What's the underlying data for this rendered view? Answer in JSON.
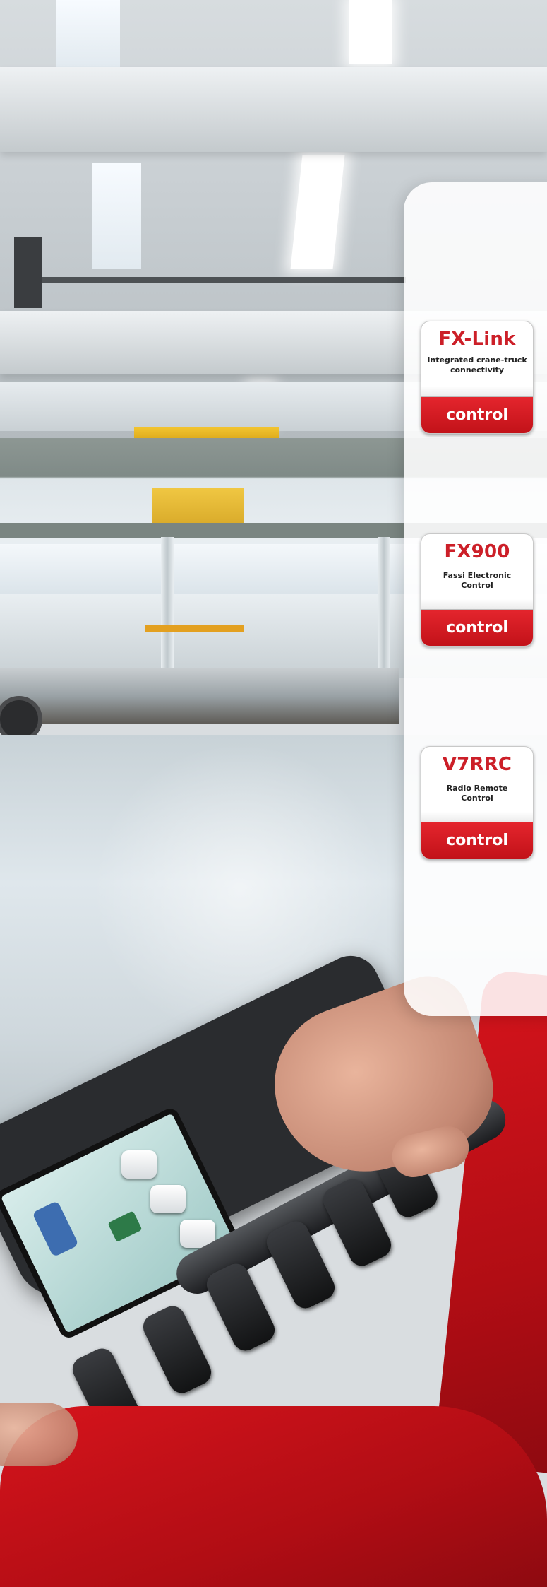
{
  "badges": [
    {
      "title": "FX-Link",
      "subtitle": "Integrated crane-truck\nconnectivity",
      "footer": "control"
    },
    {
      "title": "FX900",
      "subtitle": "Fassi Electronic\nControl",
      "footer": "control"
    },
    {
      "title": "V7RRC",
      "subtitle": "Radio Remote\nControl",
      "footer": "control"
    }
  ],
  "colors": {
    "brand_red": "#cc1f28",
    "jacket_red": "#c8101a"
  }
}
